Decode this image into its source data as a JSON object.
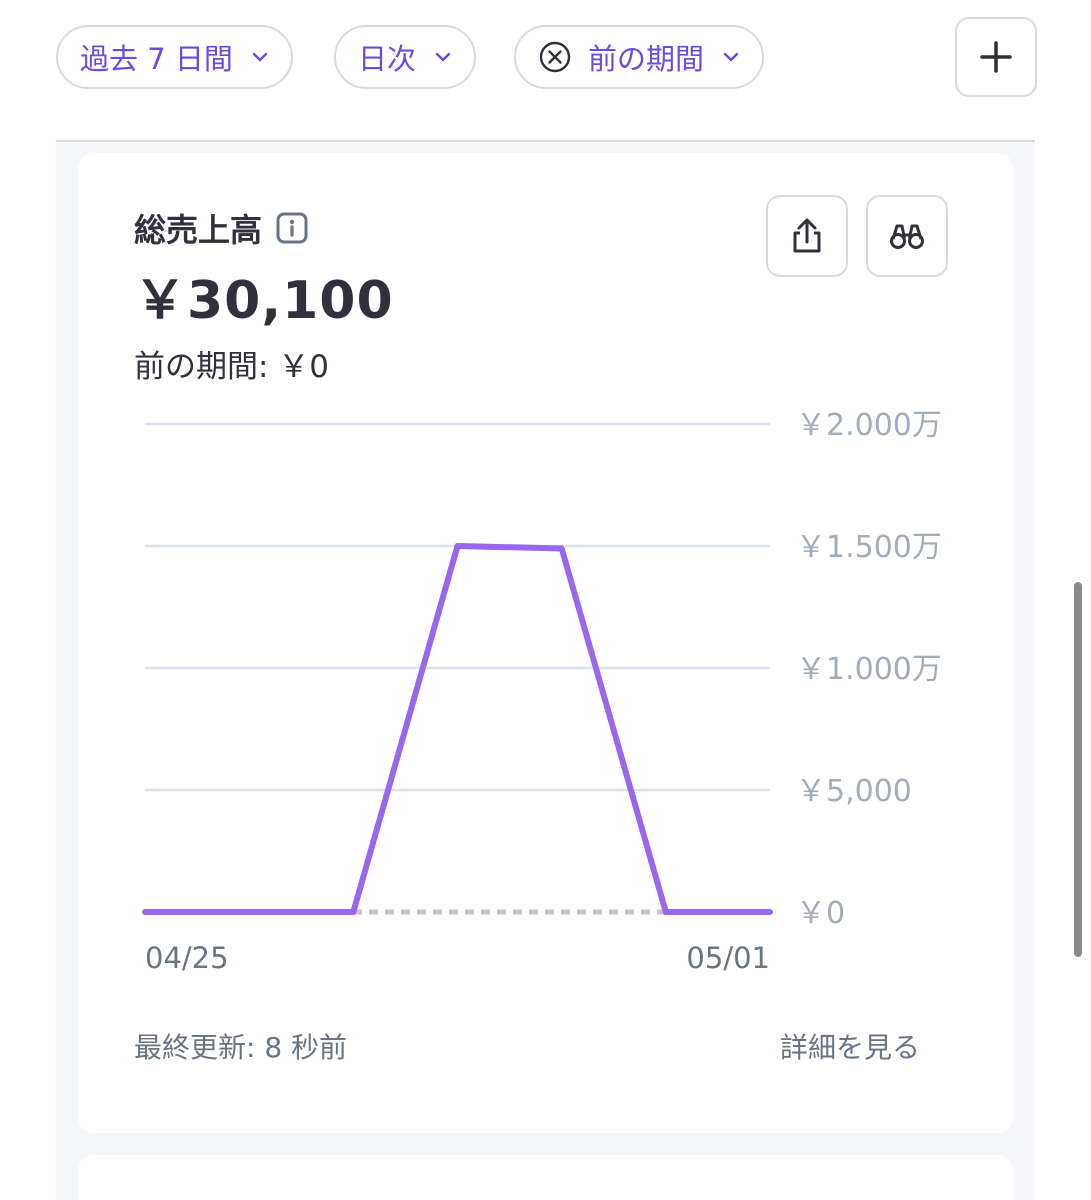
{
  "filters": {
    "period": "過去 7 日間",
    "interval": "日次",
    "compare": "前の期間"
  },
  "card": {
    "title": "総売上高",
    "total": "￥30,100",
    "previous": "前の期間: ￥0",
    "updated": "最終更新: 8 秒前",
    "details_link": "詳細を見る"
  },
  "icons": {
    "add": "plus-icon",
    "export": "share-upload-icon",
    "explore": "binoculars-icon",
    "info": "info-icon",
    "clear": "x-circle-icon",
    "dropdown": "chevron-down-icon"
  },
  "colors": {
    "accent": "#6c4ae0",
    "line": "#9966ee",
    "grid": "#dde1e9",
    "axis_text": "#a3acba"
  },
  "chart_data": {
    "type": "line",
    "x_tick_labels": [
      "04/25",
      "05/01"
    ],
    "y_tick_labels": [
      "￥0",
      "￥5,000",
      "￥1.000万",
      "￥1.500万",
      "￥2.000万"
    ],
    "ylim": [
      0,
      20000
    ],
    "grid": true,
    "series": [
      {
        "values": [
          0,
          0,
          0,
          15000,
          14900,
          0,
          0
        ]
      },
      {
        "values": [
          0,
          0,
          0,
          0,
          0,
          0,
          0
        ]
      }
    ]
  }
}
